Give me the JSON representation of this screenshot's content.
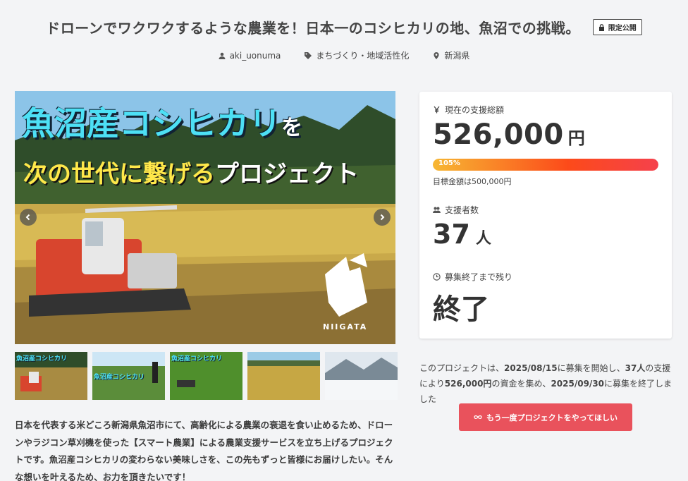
{
  "project": {
    "title": "ドローンでワクワクするような農業を！日本一のコシヒカリの地、魚沼での挑戦。",
    "badge": "限定公開",
    "author": "aki_uonuma",
    "category": "まちづくり・地域活性化",
    "location": "新潟県"
  },
  "hero": {
    "line1_main": "魚沼産コシヒカリ",
    "line1_particle": "を",
    "line2_highlight": "次の世代に繋げる",
    "line2_rest": "プロジェクト",
    "region_label": "NIIGATA"
  },
  "thumbnails": [
    {
      "label": "魚沼産コシヒカリ"
    },
    {
      "label": "魚沼産コシヒカリ"
    },
    {
      "label": "魚沼産コシヒカリ"
    },
    {
      "label": ""
    },
    {
      "label": ""
    }
  ],
  "description": "日本を代表する米どころ新潟県魚沼市にて、高齢化による農業の衰退を食い止めるため、ドローンやラジコン草刈機を使った【スマート農業】による農業支援サービスを立ち上げるプロジェクトです。魚沼産コシヒカリの変わらない美味しさを、この先もずっと皆様にお届けしたい。そんな想いを叶えるため、お力を頂きたいです！",
  "stats": {
    "total_label": "現在の支援総額",
    "total_amount": "526,000",
    "currency_unit": "円",
    "progress_percent": 105,
    "progress_text": "105%",
    "goal_text": "目標金額は500,000円",
    "supporters_label": "支援者数",
    "supporters_count": "37",
    "supporters_unit": "人",
    "remaining_label": "募集終了まで残り",
    "remaining_value": "終了"
  },
  "summary": {
    "prefix": "このプロジェクトは、",
    "start_date": "2025/08/15",
    "mid1": "に募集を開始し、",
    "supporters": "37人",
    "mid2": "の支援により",
    "amount": "526,000円",
    "mid3": "の資金を集め、",
    "end_date": "2025/09/30",
    "suffix": "に募集を終了しました"
  },
  "again_button": "もう一度プロジェクトをやってほしい",
  "colors": {
    "accent_button": "#e9525c",
    "progress_start": "#f7b733",
    "progress_end": "#f5414c",
    "page_bg": "#f3f4f6"
  }
}
